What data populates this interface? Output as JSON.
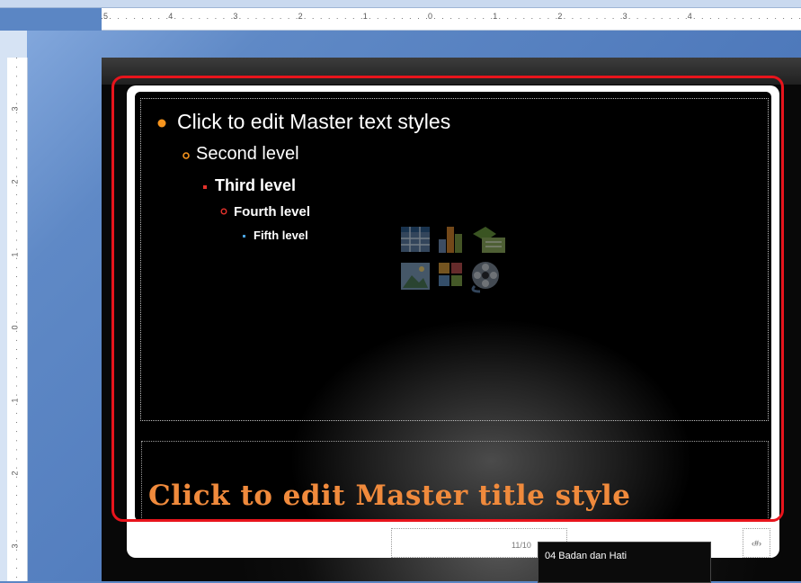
{
  "ruler": {
    "h_numbers": [
      "5",
      "4",
      "3",
      "2",
      "1",
      "0",
      "1",
      "2",
      "3",
      "4"
    ],
    "v_numbers": [
      "3",
      "2",
      "1",
      "0",
      "1",
      "2",
      "3"
    ]
  },
  "slide": {
    "body_levels": [
      "Click to edit Master text styles",
      "Second level",
      "Third level",
      "Fourth level",
      "Fifth level"
    ],
    "title": "Click to edit Master title style",
    "date_fragment": "11/10",
    "slide_number": "‹#›",
    "content_icons": [
      "insert-table-icon",
      "insert-chart-icon",
      "insert-smartart-icon",
      "insert-picture-icon",
      "insert-clip-art-icon",
      "insert-media-icon"
    ]
  },
  "tooltip": {
    "label": "04 Badan dan Hati"
  },
  "colors": {
    "accent": "#f08a3c",
    "highlight": "#e8141c",
    "bullet_orange": "#f7941d",
    "bullet_red": "#e5322b",
    "workspace": "#5b86c4"
  }
}
